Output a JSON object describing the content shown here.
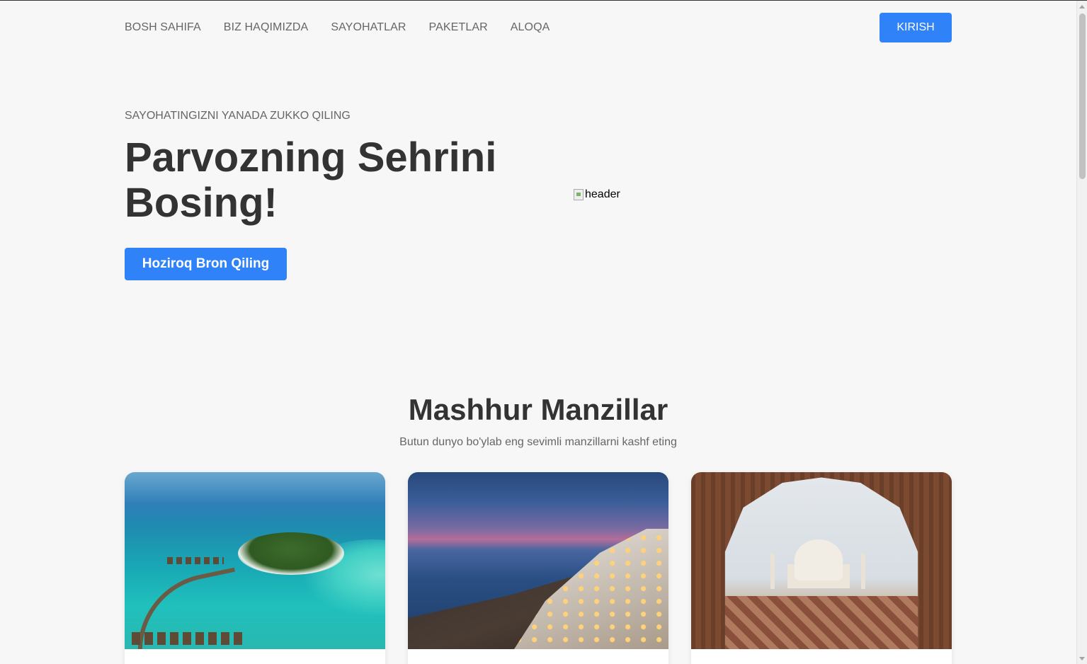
{
  "nav": {
    "links": [
      "BOSH SAHIFA",
      "BIZ HAQIMIZDA",
      "SAYOHATLAR",
      "PAKETLAR",
      "ALOQA"
    ],
    "login_label": "KIRISH",
    "accent_color": "#2f82f7"
  },
  "hero": {
    "subtitle": "SAYOHATINGIZNI YANADA ZUKKO QILING",
    "title": "Parvozning Sehrini Bosing!",
    "cta_label": "Hoziroq Bron Qiling",
    "image_alt": "header"
  },
  "destinations": {
    "title": "Mashhur Manzillar",
    "subtitle": "Butun dunyo bo'ylab eng sevimli manzillarni kashf eting"
  }
}
